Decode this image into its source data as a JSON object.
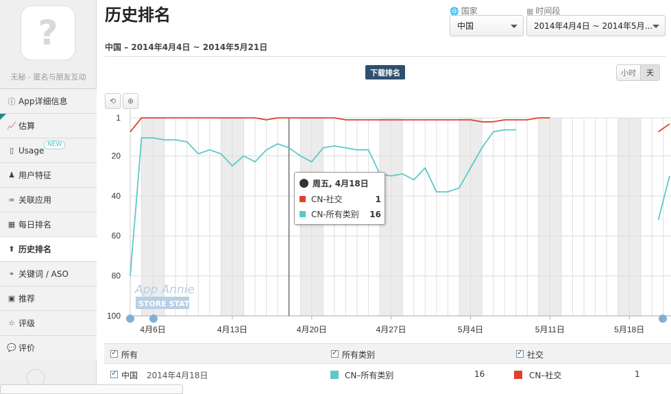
{
  "app": {
    "icon_glyph": "?",
    "name": "无秘 - 匿名与朋友互动"
  },
  "nav": [
    {
      "label": "App详细信息",
      "icon": "info-icon",
      "glyph": "ⓘ"
    },
    {
      "label": "估算",
      "icon": "chart-line-icon",
      "glyph": "📈"
    },
    {
      "label": "Usage",
      "icon": "phone-usage-icon",
      "glyph": "▯",
      "badge": "NEW"
    },
    {
      "label": "用户特征",
      "icon": "person-icon",
      "glyph": "♟"
    },
    {
      "label": "关联应用",
      "icon": "link-icon",
      "glyph": "∞"
    },
    {
      "label": "每日排名",
      "icon": "calendar-icon",
      "glyph": "▦"
    },
    {
      "label": "历史排名",
      "icon": "arrow-up-icon",
      "glyph": "⬆"
    },
    {
      "label": "关键词 / ASO",
      "icon": "keyword-icon",
      "glyph": "⌖"
    },
    {
      "label": "推荐",
      "icon": "featured-icon",
      "glyph": "▣"
    },
    {
      "label": "评级",
      "icon": "star-icon",
      "glyph": "☆"
    },
    {
      "label": "评价",
      "icon": "comment-icon",
      "glyph": "💬"
    }
  ],
  "header": {
    "title": "历史排名",
    "subtitle": "中国 – 2014年4月4日 ~ 2014年5月21日",
    "country_label": "国家",
    "country_value": "中国",
    "period_label": "时间段",
    "period_value": "2014年4月4日 ~ 2014年5月..."
  },
  "controls": {
    "rank_type": "下载排名",
    "granularity": [
      "小时",
      "天"
    ],
    "active_granularity": "天",
    "reset_icon": "undo-icon",
    "zoom_icon": "zoom-in-icon"
  },
  "watermark": {
    "line1": "App Annie",
    "line2": "STORE STATS"
  },
  "chart_data": {
    "type": "line",
    "inverted_y": true,
    "ylim": [
      1,
      100
    ],
    "yticks": [
      1,
      20,
      40,
      60,
      80,
      100
    ],
    "x_start": "2014-04-04",
    "x_end": "2014-05-21",
    "xticks": [
      "4月6日",
      "4月13日",
      "4月20日",
      "4月27日",
      "5月4日",
      "5月11日",
      "5月18日"
    ],
    "series": [
      {
        "name": "CN-社交",
        "color": "#e0402a",
        "segments": [
          [
            8,
            1,
            1,
            1,
            1,
            1,
            1,
            1,
            1,
            1,
            1,
            1,
            2,
            1,
            1,
            1,
            1,
            1,
            1,
            2,
            2,
            2,
            2,
            2,
            2,
            2,
            2,
            2,
            2,
            2,
            2,
            3,
            3,
            2,
            2,
            2,
            1,
            1
          ],
          [
            8,
            4
          ]
        ]
      },
      {
        "name": "CN-所有类别",
        "color": "#5cc8c8",
        "segments": [
          [
            80,
            11,
            11,
            12,
            12,
            13,
            19,
            17,
            19,
            25,
            20,
            23,
            17,
            14,
            16,
            20,
            23,
            16,
            15,
            16,
            17,
            17,
            29,
            30,
            29,
            32,
            26,
            38,
            38,
            36,
            26,
            16,
            8,
            7,
            7
          ],
          [
            52,
            30
          ]
        ]
      }
    ],
    "tooltip": {
      "date": "周五, 4月18日",
      "rows": [
        {
          "name": "CN-社交",
          "value": 1,
          "color": "#e0402a"
        },
        {
          "name": "CN-所有类别",
          "value": 16,
          "color": "#5cc8c8"
        }
      ]
    }
  },
  "legend": {
    "headers": [
      "所有",
      "所有类别",
      "社交"
    ],
    "row": {
      "country": "中国",
      "date": "2014年4月18日",
      "all_categories_name": "CN–所有类别",
      "all_categories_value": "16",
      "social_name": "CN–社交",
      "social_value": "1"
    }
  }
}
